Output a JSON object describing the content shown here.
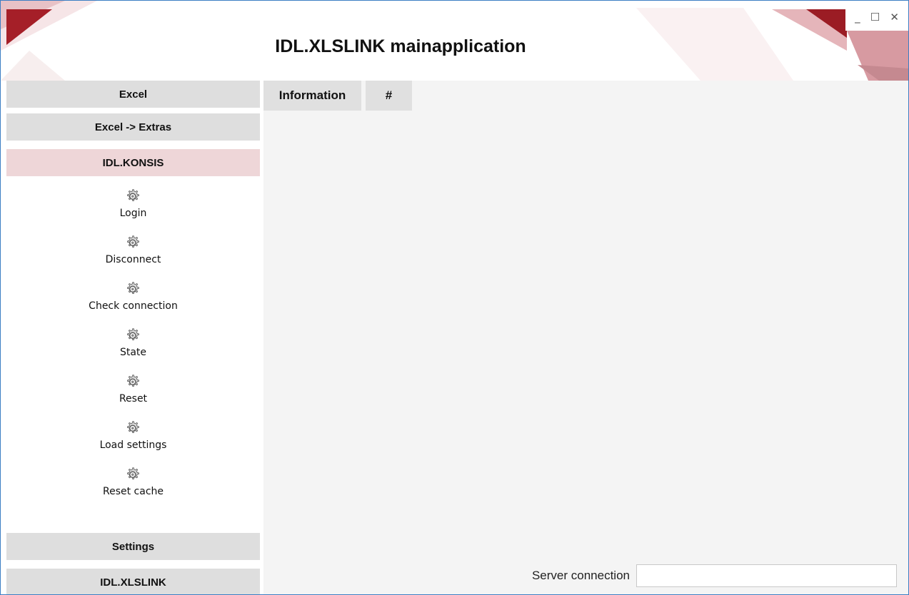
{
  "window": {
    "title": "IDL.XLSLINK mainapplication",
    "controls": {
      "minimize": "_",
      "maximize": "☐",
      "close": "✕"
    }
  },
  "sidebar": {
    "top_buttons": [
      {
        "label": "Excel"
      },
      {
        "label": "Excel -> Extras"
      },
      {
        "label": "IDL.KONSIS",
        "active": true
      }
    ],
    "tools": [
      {
        "label": "Login",
        "icon": "gear-icon"
      },
      {
        "label": "Disconnect",
        "icon": "gear-icon"
      },
      {
        "label": "Check connection",
        "icon": "gear-icon"
      },
      {
        "label": "State",
        "icon": "gear-icon"
      },
      {
        "label": "Reset",
        "icon": "gear-icon"
      },
      {
        "label": "Load settings",
        "icon": "gear-icon"
      },
      {
        "label": "Reset cache",
        "icon": "gear-icon"
      }
    ],
    "bottom_buttons": [
      {
        "label": "Settings"
      },
      {
        "label": "IDL.XLSLINK"
      }
    ]
  },
  "main": {
    "tabs": [
      {
        "label": "Information"
      },
      {
        "label": "#"
      }
    ]
  },
  "status": {
    "label": "Server connection",
    "value": ""
  },
  "colors": {
    "accent": "#9b1c24",
    "active_section": "#eed6d8",
    "button_bg": "#dedede",
    "window_border": "#3c7fc4"
  }
}
